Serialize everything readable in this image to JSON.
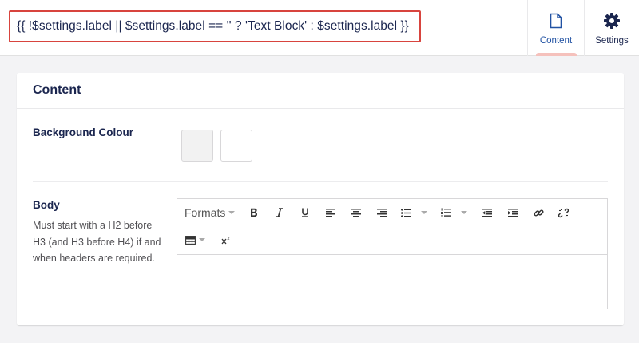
{
  "header": {
    "title": "{{ !$settings.label || $settings.label == '' ? 'Text Block' : $settings.label }}",
    "tabs": [
      {
        "label": "Content",
        "icon": "document-icon",
        "active": true
      },
      {
        "label": "Settings",
        "icon": "gear-icon",
        "active": false
      }
    ]
  },
  "panel": {
    "title": "Content",
    "properties": {
      "background": {
        "label": "Background Colour",
        "swatches": [
          "#f2f2f2",
          "#ffffff"
        ]
      },
      "body": {
        "label": "Body",
        "description": "Must start with a H2 before H3 (and H3 before H4) if and when headers are required.",
        "editor": {
          "formats_label": "Formats",
          "toolbar_icons": [
            "bold-icon",
            "italic-icon",
            "underline-icon",
            "align-left-icon",
            "align-center-icon",
            "align-right-icon",
            "bullet-list-icon",
            "numbered-list-icon",
            "outdent-icon",
            "indent-icon",
            "link-icon",
            "unlink-icon",
            "table-icon",
            "superscript-icon"
          ],
          "content": ""
        }
      }
    }
  },
  "colors": {
    "accent_red": "#d8443e",
    "active_tab_bar": "#f5c1bc",
    "active_tab_text": "#2152a3",
    "text_dark": "#1b264f"
  }
}
